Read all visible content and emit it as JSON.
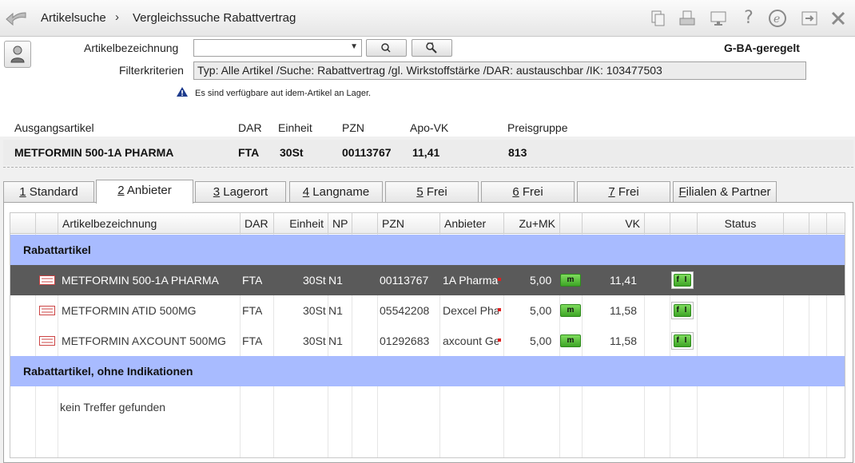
{
  "breadcrumb": {
    "first": "Artikelsuche",
    "separator": "›",
    "second": "Vergleichssuche Rabattvertrag"
  },
  "toolbar_icons": [
    "documents-icon",
    "print-icon",
    "monitor-icon",
    "help-icon",
    "e-icon",
    "export-icon",
    "close-icon"
  ],
  "search": {
    "article_label": "Artikelbezeichnung",
    "article_value": "",
    "filter_label": "Filterkriterien",
    "filter_value": "Typ: Alle Artikel /Suche: Rabattvertrag /gl. Wirkstoffstärke /DAR: austauschbar /IK: 103477503",
    "gba_label": "G-BA-geregelt",
    "info_text": "Es sind verfügbare aut idem-Artikel an Lager."
  },
  "original": {
    "headers": {
      "name": "Ausgangsartikel",
      "dar": "DAR",
      "unit": "Einheit",
      "pzn": "PZN",
      "price": "Apo-VK",
      "group": "Preisgruppe"
    },
    "values": {
      "name": "METFORMIN 500-1A PHARMA",
      "dar": "FTA",
      "unit": "30St",
      "pzn": "00113767",
      "price": "11,41",
      "group": "813"
    }
  },
  "tabs": [
    {
      "key": "1",
      "label": " Standard"
    },
    {
      "key": "2",
      "label": " Anbieter"
    },
    {
      "key": "3",
      "label": " Lagerort"
    },
    {
      "key": "4",
      "label": " Langname"
    },
    {
      "key": "5",
      "label": " Frei"
    },
    {
      "key": "6",
      "label": " Frei"
    },
    {
      "key": "7",
      "label": " Frei"
    },
    {
      "key": "F",
      "label": "ilialen & Partner"
    }
  ],
  "active_tab": "2",
  "columns": {
    "name": "Artikelbezeichnung",
    "dar": "DAR",
    "unit": "Einheit",
    "np": "NP",
    "pzn": "PZN",
    "supplier": "Anbieter",
    "zumk": "Zu+MK",
    "vk": "VK",
    "status": "Status"
  },
  "groups": [
    {
      "title": "Rabattartikel"
    },
    {
      "title": "Rabattartikel, ohne Indikationen"
    }
  ],
  "rows": [
    {
      "name": "METFORMIN 500-1A PHARMA",
      "dar": "FTA",
      "unit": "30St",
      "np": "N1",
      "pzn": "00113767",
      "supplier": "1A Pharma",
      "zumk": "5,00",
      "m": "m",
      "vk": "11,41",
      "fi": "f I"
    },
    {
      "name": "METFORMIN ATID 500MG",
      "dar": "FTA",
      "unit": "30St",
      "np": "N1",
      "pzn": "05542208",
      "supplier": "Dexcel Pha",
      "zumk": "5,00",
      "m": "m",
      "vk": "11,58",
      "fi": "f I"
    },
    {
      "name": "METFORMIN AXCOUNT 500MG",
      "dar": "FTA",
      "unit": "30St",
      "np": "N1",
      "pzn": "01292683",
      "supplier": "axcount Ge",
      "zumk": "5,00",
      "m": "m",
      "vk": "11,58",
      "fi": "f I"
    }
  ],
  "empty_text": "kein Treffer gefunden",
  "colors": {
    "group_bg": "#a8bbff",
    "selected_row": "#5a5a5a",
    "badge_green": "#52c234"
  }
}
